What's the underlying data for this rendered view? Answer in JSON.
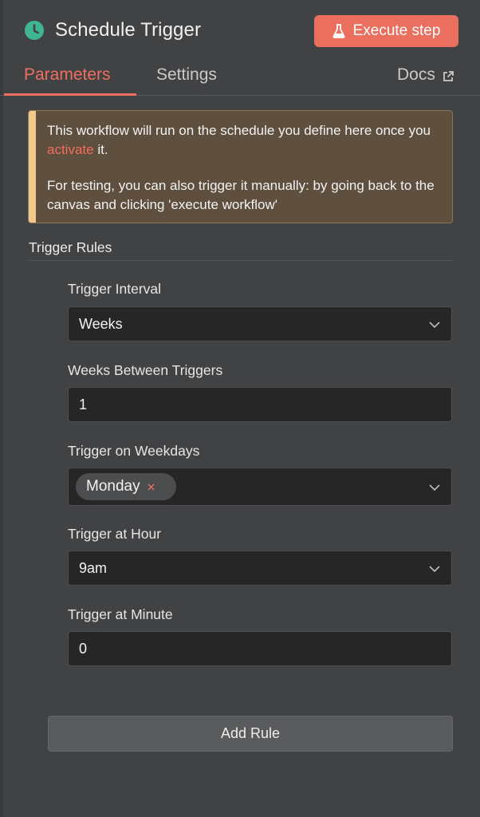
{
  "header": {
    "title": "Schedule Trigger",
    "execute_label": "Execute step",
    "accent_color": "#ea6f5f",
    "node_icon": "clock-icon"
  },
  "tabs": [
    {
      "label": "Parameters",
      "active": true
    },
    {
      "label": "Settings",
      "active": false
    },
    {
      "label": "Docs",
      "active": false,
      "icon": "external-link-icon"
    }
  ],
  "notice": {
    "line1_before": "This workflow will run on the schedule you define here once you ",
    "link": "activate",
    "line1_after": " it.",
    "line2": "For testing, you can also trigger it manually: by going back to the canvas and clicking 'execute workflow'"
  },
  "section": {
    "title": "Trigger Rules"
  },
  "fields": {
    "interval": {
      "label": "Trigger Interval",
      "value": "Weeks"
    },
    "weeks_between": {
      "label": "Weeks Between Triggers",
      "value": "1"
    },
    "weekdays": {
      "label": "Trigger on Weekdays",
      "chips": [
        "Monday"
      ]
    },
    "hour": {
      "label": "Trigger at Hour",
      "value": "9am"
    },
    "minute": {
      "label": "Trigger at Minute",
      "value": "0"
    }
  },
  "add_rule_label": "Add Rule"
}
